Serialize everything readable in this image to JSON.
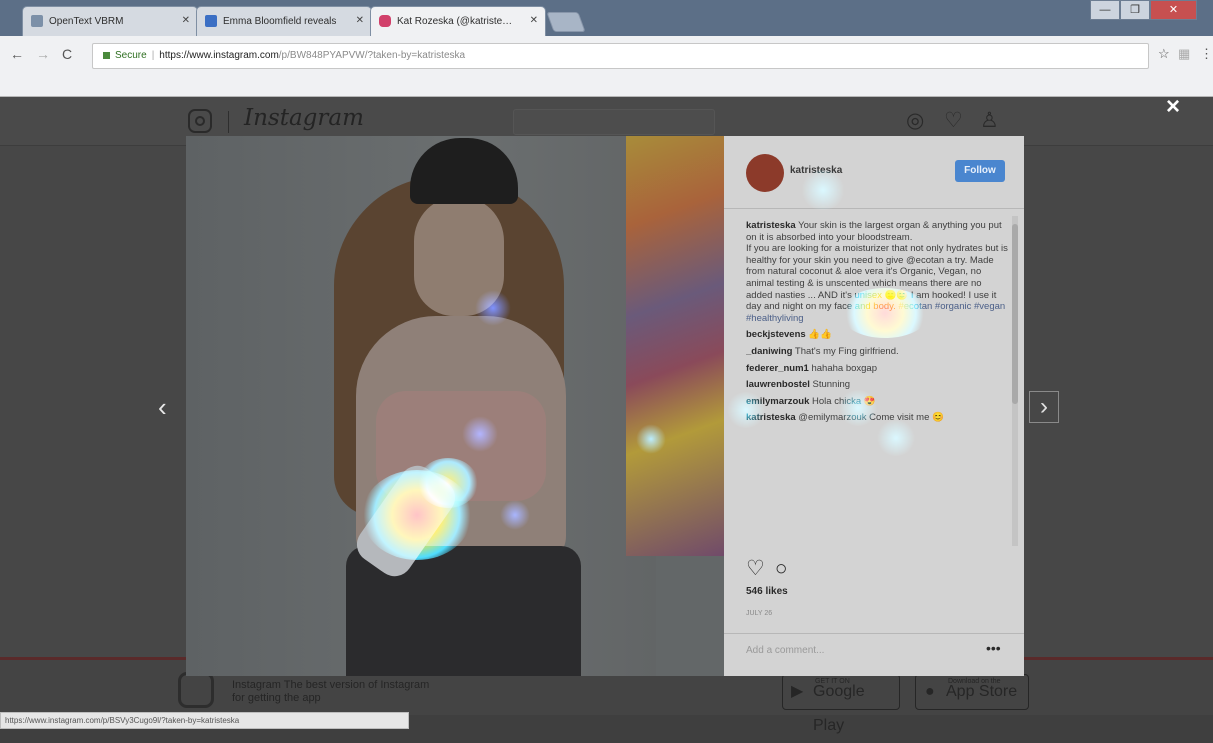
{
  "browser": {
    "tabs": [
      {
        "label": "OpenText VBRM",
        "favicon_color": "#7c90a8",
        "active": false
      },
      {
        "label": "Emma Bloomfield reveals",
        "favicon_color": "#3b6fc4",
        "active": false
      },
      {
        "label": "Kat Rozeska (@katriste…",
        "favicon_color": "#d1406a",
        "active": true
      }
    ],
    "url": {
      "secure_label": "Secure",
      "host": "https://www.instagram.com",
      "path": "/p/BW848PYAPVW/?taken-by=katristeska"
    },
    "window_controls": [
      "—",
      "❐",
      "✕"
    ]
  },
  "instagram": {
    "wordmark": "Instagram",
    "close": "×",
    "prev_arrow": "‹",
    "next_arrow": "›"
  },
  "post": {
    "author": "katristeska",
    "follow_label": "Follow",
    "caption": {
      "user": "katristeska",
      "text": "Your skin is the largest organ & anything you put on it is absorbed into your bloodstream.\nIf you are looking for a moisturizer that not only hydrates but is healthy for your skin you need to give @ecotan a try. Made from natural coconut & aloe vera it's Organic, Vegan, no animal testing & is unscented which means there are no added nasties ... AND it's unisex 😊😊 I am hooked! I use it day and night on my face and body.",
      "hashtags": "#ecotan #organic #vegan #healthyliving"
    },
    "comments": [
      {
        "user": "beckjstevens",
        "text": "👍👍"
      },
      {
        "user": "_daniwing",
        "text": "That's my Fing girlfriend."
      },
      {
        "user": "federer_num1",
        "text": "hahaha boxgap"
      },
      {
        "user": "lauwrenbostel",
        "text": "Stunning"
      },
      {
        "user": "emilymarzouk",
        "text": "Hola chicka 😍"
      },
      {
        "user": "katristeska",
        "text": "@emilymarzouk Come visit me 😊"
      }
    ],
    "likes": "546 likes",
    "date": "JULY 26",
    "add_comment_placeholder": "Add a comment...",
    "more": "•••"
  },
  "footer": {
    "promo_text": "Instagram The best version of Instagram for getting the app",
    "google_play_small": "GET IT ON",
    "google_play": "Google Play",
    "app_store_small": "Download on the",
    "app_store": "App Store"
  },
  "status_bar": "https://www.instagram.com/p/BSVy3Cugo9l/?taken-by=katristeska",
  "heatmap_colors": [
    "#ff2a2a",
    "#ffe100",
    "#2bd6ff",
    "#3a6bff"
  ]
}
